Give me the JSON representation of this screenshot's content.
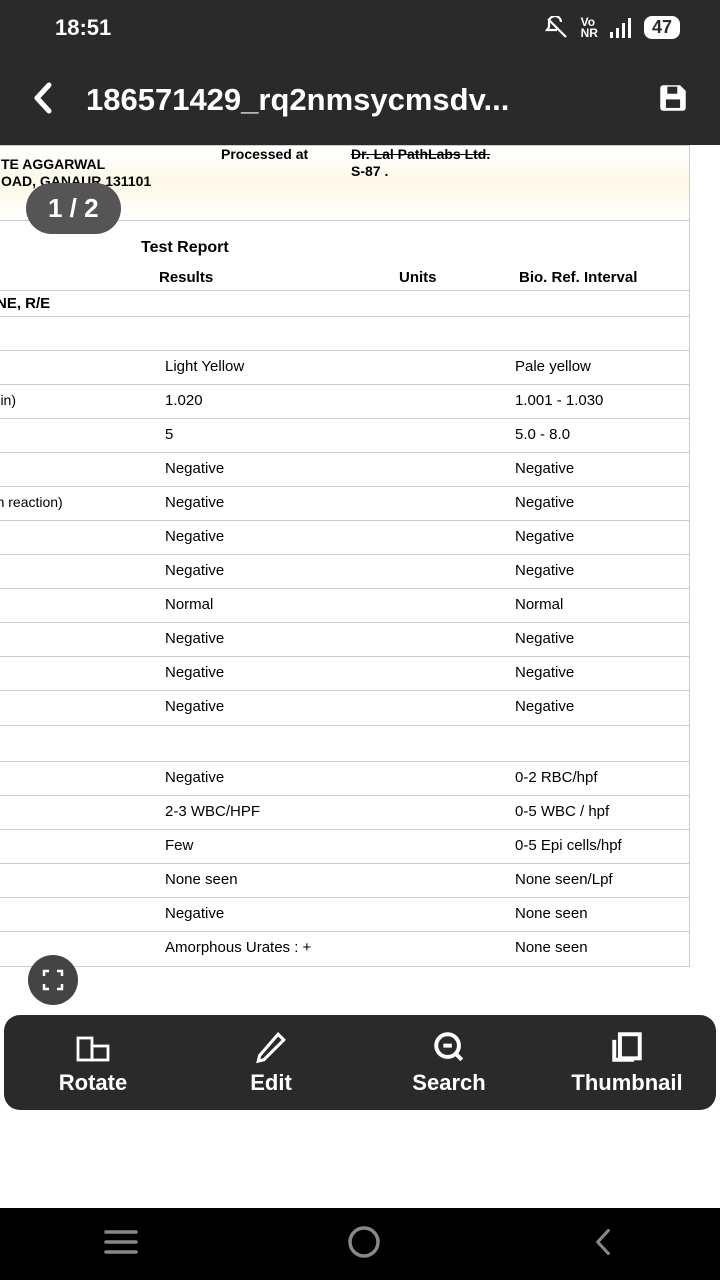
{
  "status": {
    "time": "18:51",
    "battery": "47",
    "network": "Vo\nNR"
  },
  "header": {
    "title": "186571429_rq2nmsycmsdv..."
  },
  "page_indicator": "1 / 2",
  "doc": {
    "addr_line1": "TE AGGARWAL",
    "addr_line2": "OAD, GANAUR 131101",
    "processed_at_label": "Processed at",
    "processed_at_value": "Dr. Lal PathLabs Ltd.",
    "processed_at_line2": "S-87 .",
    "title": "Test Report",
    "columns": {
      "results": "Results",
      "units": "Units",
      "ref": "Bio. Ref. Interval"
    },
    "section": "RINE, R/E",
    "rows": [
      {
        "name": "",
        "results": "",
        "units": "",
        "ref": ""
      },
      {
        "name": "",
        "results": "Light Yellow",
        "units": "",
        "ref": "Pale yellow"
      },
      {
        "name": "resin)",
        "results": "1.020",
        "units": "",
        "ref": "1.001 - 1.030"
      },
      {
        "name": "",
        "results": "5",
        "units": "",
        "ref": "5.0 - 8.0"
      },
      {
        "name": "",
        "results": "Negative",
        "units": "",
        "ref": "Negative"
      },
      {
        "name": "gen reaction)",
        "results": "Negative",
        "units": "",
        "ref": "Negative"
      },
      {
        "name": "",
        "results": "Negative",
        "units": "",
        "ref": "Negative"
      },
      {
        "name": "",
        "results": "Negative",
        "units": "",
        "ref": "Negative"
      },
      {
        "name": "",
        "results": "Normal",
        "units": "",
        "ref": "Normal"
      },
      {
        "name": "",
        "results": "Negative",
        "units": "",
        "ref": "Negative"
      },
      {
        "name": "",
        "results": "Negative",
        "units": "",
        "ref": "Negative"
      },
      {
        "name": "",
        "results": "Negative",
        "units": "",
        "ref": "Negative"
      }
    ],
    "rows2": [
      {
        "name": "",
        "results": "Negative",
        "units": "",
        "ref": "0-2 RBC/hpf"
      },
      {
        "name": "",
        "results": "2-3 WBC/HPF",
        "units": "",
        "ref": "0-5 WBC / hpf"
      },
      {
        "name": "",
        "results": "Few",
        "units": "",
        "ref": "0-5 Epi cells/hpf"
      },
      {
        "name": "",
        "results": "None seen",
        "units": "",
        "ref": "None seen/Lpf"
      },
      {
        "name": "",
        "results": "Negative",
        "units": "",
        "ref": "None seen"
      },
      {
        "name": "",
        "results": "Amorphous Urates : +",
        "units": "",
        "ref": "None seen"
      }
    ]
  },
  "toolbar": {
    "rotate": "Rotate",
    "edit": "Edit",
    "search": "Search",
    "thumbnail": "Thumbnail"
  }
}
